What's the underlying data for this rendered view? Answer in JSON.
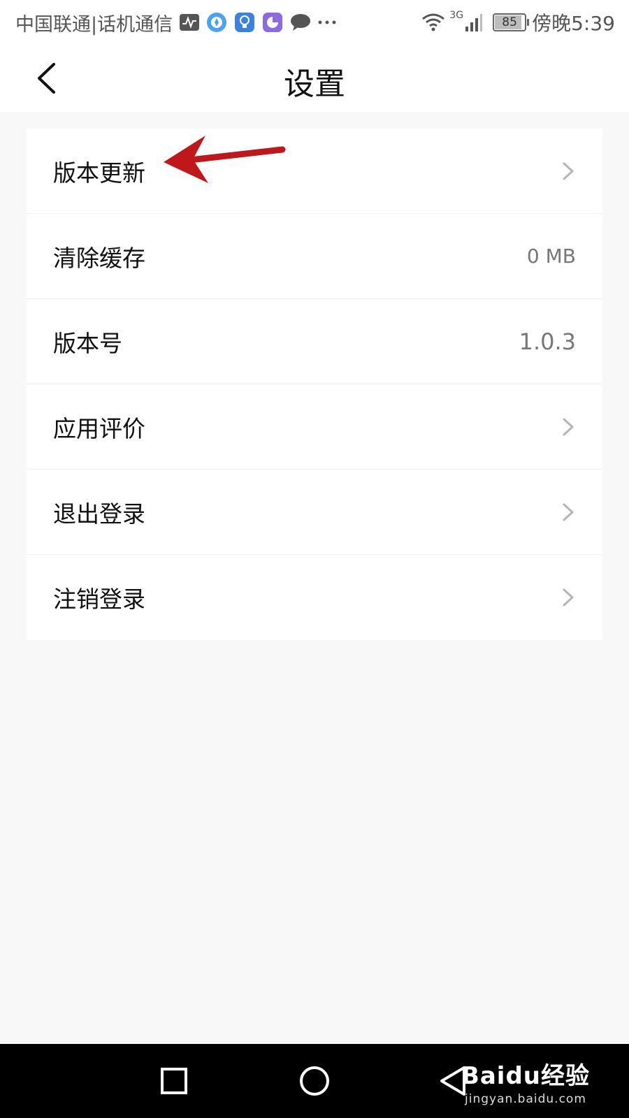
{
  "status_bar": {
    "carrier": "中国联通|话机通信",
    "battery": "85",
    "time": "傍晚5:39",
    "network": "3G"
  },
  "header": {
    "title": "设置"
  },
  "settings": {
    "items": [
      {
        "label": "版本更新",
        "value": ""
      },
      {
        "label": "清除缓存",
        "value": "0 MB"
      },
      {
        "label": "版本号",
        "value": "1.0.3"
      },
      {
        "label": "应用评价",
        "value": ""
      },
      {
        "label": "退出登录",
        "value": ""
      },
      {
        "label": "注销登录",
        "value": ""
      }
    ]
  },
  "watermark": {
    "brand": "Baidu经验",
    "url": "jingyan.baidu.com"
  },
  "colors": {
    "background": "#f8f8f8",
    "annotation_arrow": "#c0171b"
  }
}
